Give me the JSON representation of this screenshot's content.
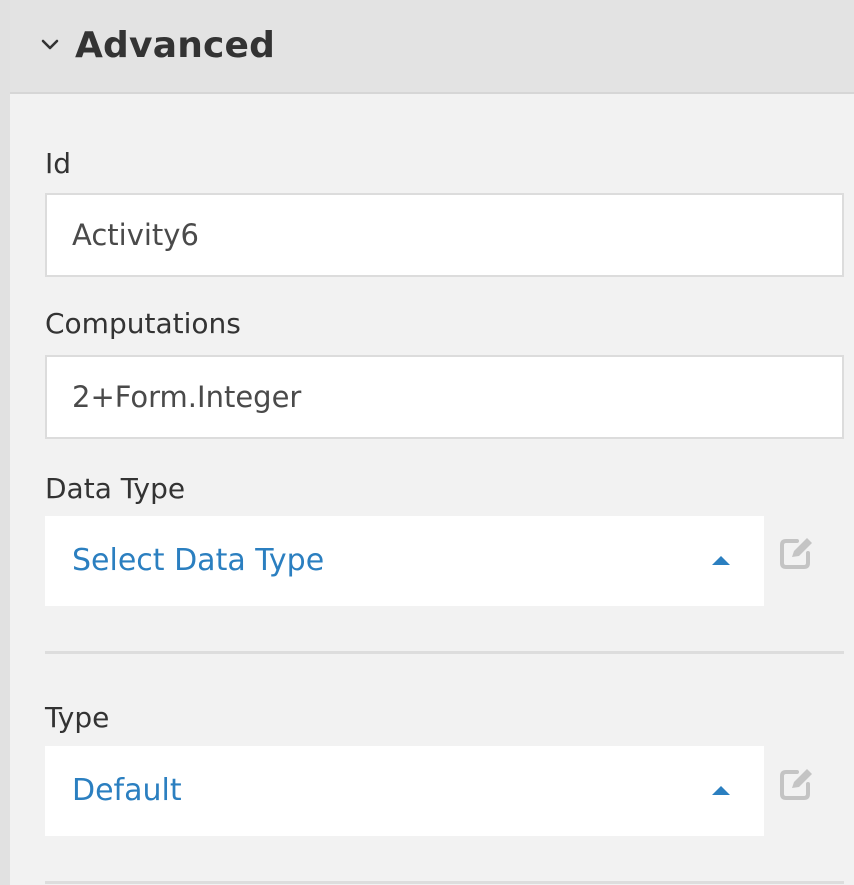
{
  "section": {
    "title": "Advanced",
    "expanded": true,
    "toggle_icon": "chevron-down-icon"
  },
  "fields": {
    "id": {
      "label": "Id",
      "value": "Activity6"
    },
    "computations": {
      "label": "Computations",
      "value": "2+Form.Integer"
    },
    "data_type": {
      "label": "Data Type",
      "selected": "Select Data Type",
      "dropdown_icon": "caret-up-icon",
      "edit_icon": "edit-icon"
    },
    "type": {
      "label": "Type",
      "selected": "Default",
      "dropdown_icon": "caret-up-icon",
      "edit_icon": "edit-icon"
    }
  },
  "colors": {
    "link_blue": "#2b7fc0",
    "header_bg": "#e3e3e3",
    "panel_bg": "#f2f2f2",
    "icon_gray": "#c4c4c4"
  }
}
